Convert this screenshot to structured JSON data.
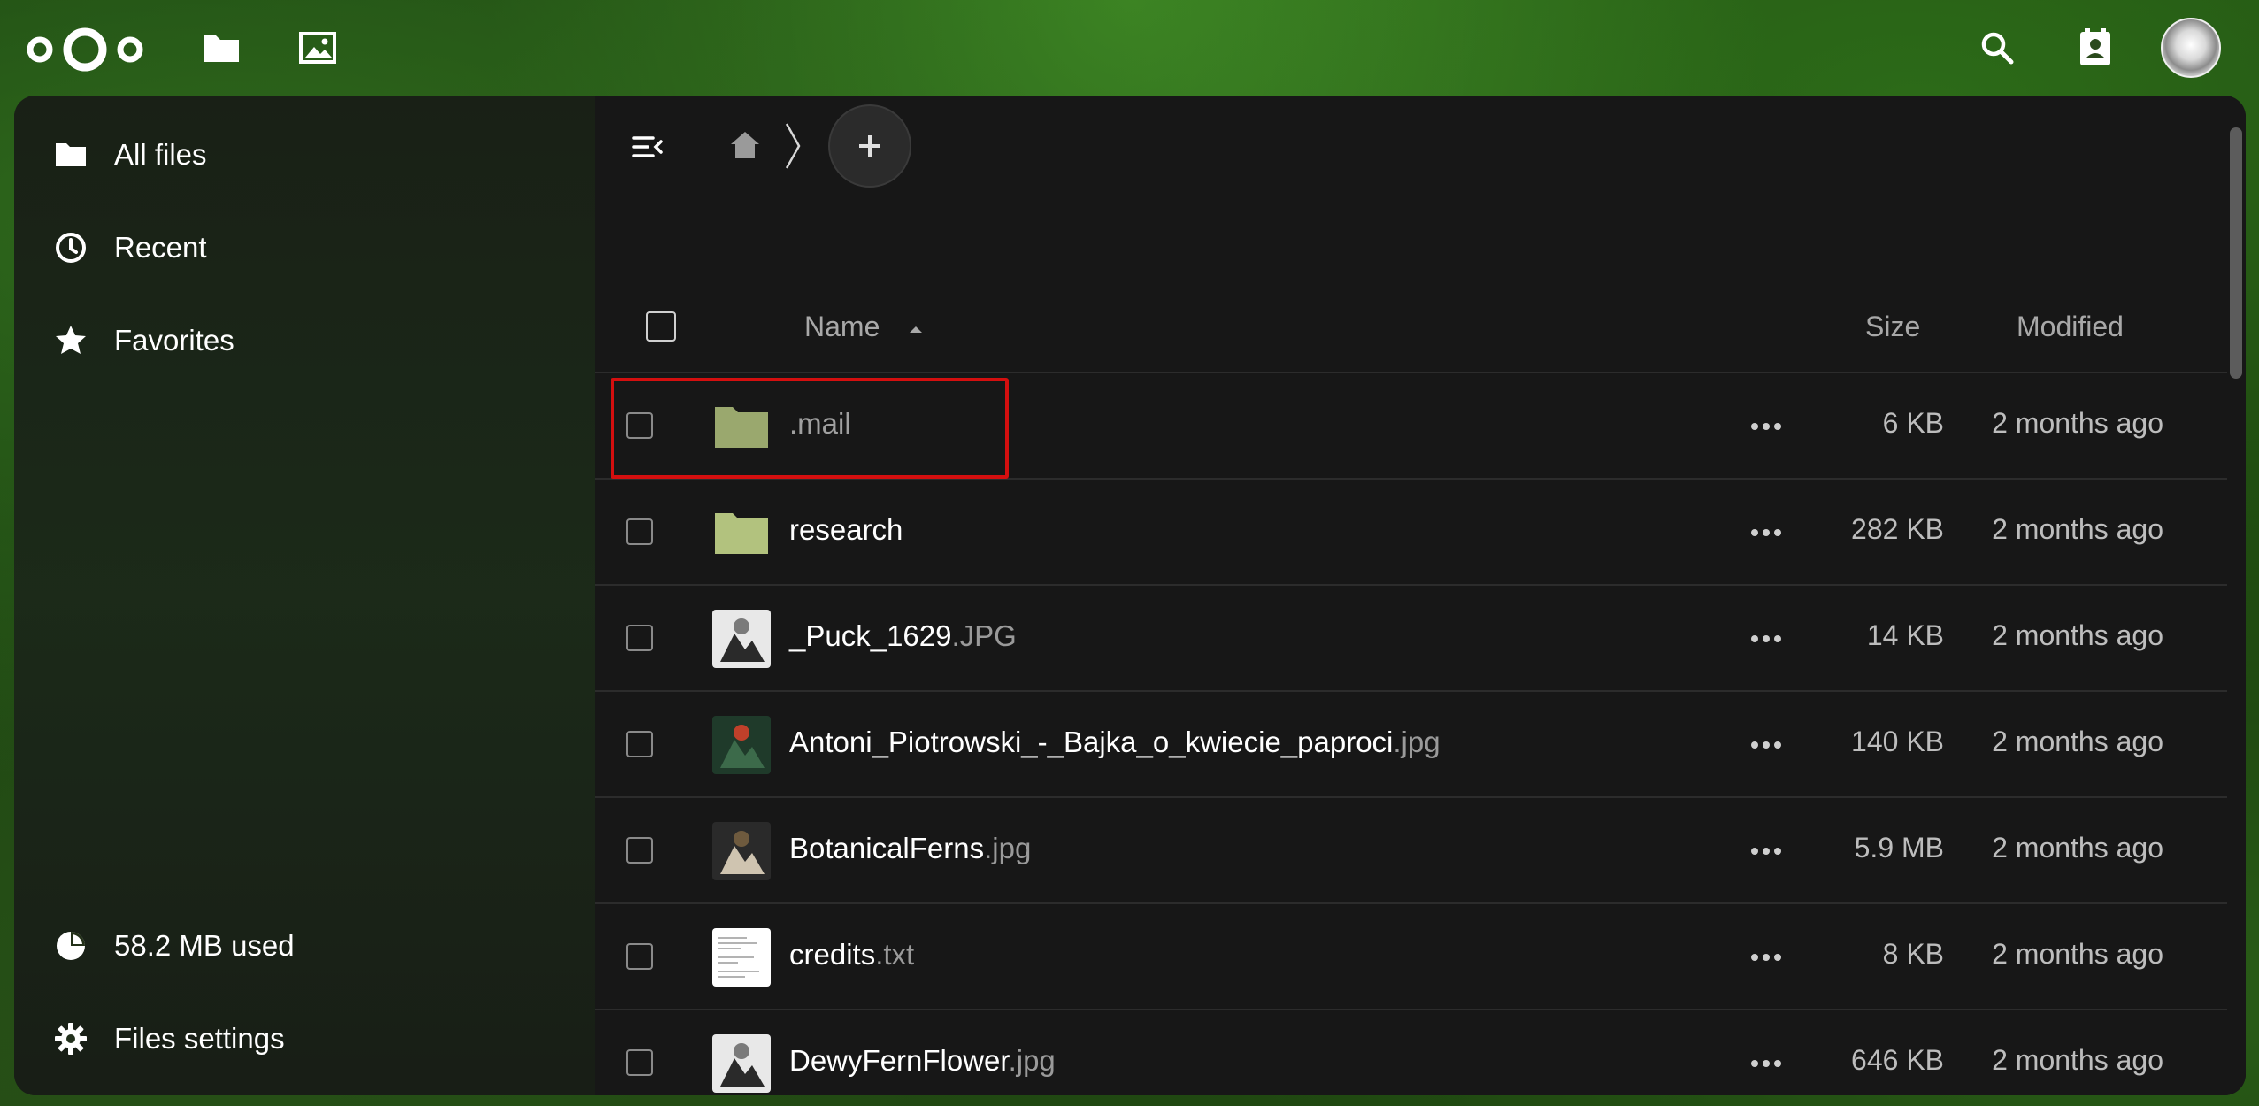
{
  "header": {
    "logo": "nextcloud-logo",
    "apps": [
      {
        "name": "Files",
        "icon": "folder-icon"
      },
      {
        "name": "Photos",
        "icon": "image-icon"
      }
    ],
    "right_icons": [
      "search-icon",
      "contacts-icon"
    ],
    "avatar": "user-avatar"
  },
  "sidebar": {
    "items": [
      {
        "label": "All files",
        "icon": "folder-icon"
      },
      {
        "label": "Recent",
        "icon": "clock-icon"
      },
      {
        "label": "Favorites",
        "icon": "star-icon"
      }
    ],
    "footer": {
      "quota_label": "58.2 MB used",
      "settings_label": "Files settings"
    }
  },
  "toolbar": {
    "breadcrumb_home_icon": "home-icon",
    "new_button_icon": "plus-icon"
  },
  "table": {
    "columns": {
      "name": "Name",
      "size": "Size",
      "modified": "Modified"
    },
    "sort": "name-ascending",
    "rows": [
      {
        "name": ".mail",
        "ext": "",
        "type": "folder",
        "size": "6 KB",
        "modified": "2 months ago",
        "dim": true
      },
      {
        "name": "research",
        "ext": "",
        "type": "folder",
        "size": "282 KB",
        "modified": "2 months ago",
        "dim": false
      },
      {
        "name": "_Puck_1629",
        "ext": ".JPG",
        "type": "image",
        "size": "14 KB",
        "modified": "2 months ago",
        "dim": false
      },
      {
        "name": "Antoni_Piotrowski_-_Bajka_o_kwiecie_paproci",
        "ext": ".jpg",
        "type": "image",
        "size": "140 KB",
        "modified": "2 months ago",
        "dim": false
      },
      {
        "name": "BotanicalFerns",
        "ext": ".jpg",
        "type": "image",
        "size": "5.9 MB",
        "modified": "2 months ago",
        "dim": false
      },
      {
        "name": "credits",
        "ext": ".txt",
        "type": "text",
        "size": "8 KB",
        "modified": "2 months ago",
        "dim": false
      },
      {
        "name": "DewyFernFlower",
        "ext": ".jpg",
        "type": "image",
        "size": "646 KB",
        "modified": "2 months ago",
        "dim": false
      }
    ]
  },
  "colors": {
    "folder": "#b2c27e",
    "highlight": "#d40f0f",
    "panel_bg": "#171717"
  }
}
